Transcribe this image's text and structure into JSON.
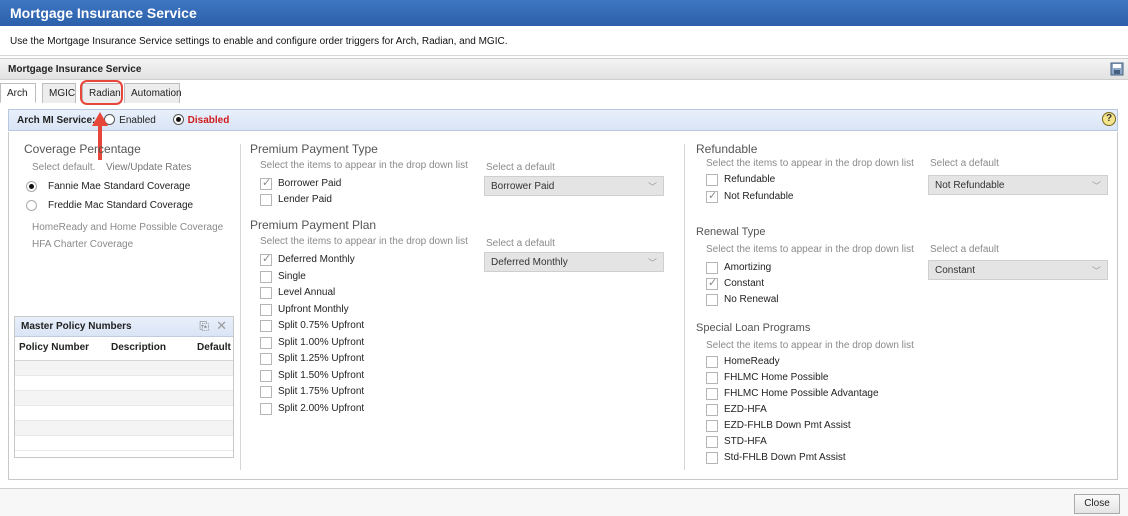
{
  "window": {
    "title": "Mortgage Insurance Service"
  },
  "description": "Use the Mortgage Insurance Service settings to enable and configure order triggers for Arch, Radian, and MGIC.",
  "section_header": "Mortgage Insurance Service",
  "tabs": [
    {
      "label": "Arch",
      "active": true
    },
    {
      "label": "MGIC",
      "active": false
    },
    {
      "label": "Radian",
      "active": false,
      "highlighted": true
    },
    {
      "label": "Automation",
      "active": false
    }
  ],
  "service": {
    "label": "Arch MI Service:",
    "enabled_label": "Enabled",
    "disabled_label": "Disabled",
    "selected": "Disabled"
  },
  "coverage": {
    "title": "Coverage Percentage",
    "select_default": "Select default.",
    "view_rates": "View/Update Rates",
    "options": [
      "Fannie Mae Standard Coverage",
      "Freddie Mac Standard Coverage"
    ],
    "selected": "Fannie Mae Standard Coverage",
    "extra": [
      "HomeReady and Home Possible Coverage",
      "HFA Charter Coverage"
    ]
  },
  "master_policy": {
    "title": "Master Policy Numbers",
    "columns": [
      "Policy Number",
      "Description",
      "Default"
    ]
  },
  "premium_payment_type": {
    "title": "Premium Payment Type",
    "hint": "Select the items to appear in the drop down list",
    "default_label": "Select a default",
    "items": [
      {
        "label": "Borrower Paid",
        "checked": true
      },
      {
        "label": "Lender Paid",
        "checked": false
      }
    ],
    "default_value": "Borrower Paid"
  },
  "premium_payment_plan": {
    "title": "Premium Payment Plan",
    "hint": "Select the items to appear in the drop down list",
    "default_label": "Select a default",
    "items": [
      {
        "label": "Deferred Monthly",
        "checked": true
      },
      {
        "label": "Single",
        "checked": false
      },
      {
        "label": "Level Annual",
        "checked": false
      },
      {
        "label": "Upfront Monthly",
        "checked": false
      },
      {
        "label": "Split 0.75% Upfront",
        "checked": false
      },
      {
        "label": "Split 1.00% Upfront",
        "checked": false
      },
      {
        "label": "Split 1.25% Upfront",
        "checked": false
      },
      {
        "label": "Split 1.50% Upfront",
        "checked": false
      },
      {
        "label": "Split 1.75% Upfront",
        "checked": false
      },
      {
        "label": "Split 2.00% Upfront",
        "checked": false
      }
    ],
    "default_value": "Deferred Monthly"
  },
  "refundable": {
    "title": "Refundable",
    "hint": "Select the items to appear in the drop down list",
    "default_label": "Select a default",
    "items": [
      {
        "label": "Refundable",
        "checked": false
      },
      {
        "label": "Not Refundable",
        "checked": true
      }
    ],
    "default_value": "Not Refundable"
  },
  "renewal_type": {
    "title": "Renewal Type",
    "hint": "Select the items to appear in the drop down list",
    "default_label": "Select a default",
    "items": [
      {
        "label": "Amortizing",
        "checked": false
      },
      {
        "label": "Constant",
        "checked": true
      },
      {
        "label": "No Renewal",
        "checked": false
      }
    ],
    "default_value": "Constant"
  },
  "special_loan": {
    "title": "Special Loan Programs",
    "hint": "Select the items to appear in the drop down list",
    "items": [
      {
        "label": "HomeReady",
        "checked": false
      },
      {
        "label": "FHLMC Home Possible",
        "checked": false
      },
      {
        "label": "FHLMC Home Possible Advantage",
        "checked": false
      },
      {
        "label": "EZD-HFA",
        "checked": false
      },
      {
        "label": "EZD-FHLB Down Pmt Assist",
        "checked": false
      },
      {
        "label": "STD-HFA",
        "checked": false
      },
      {
        "label": "Std-FHLB Down Pmt Assist",
        "checked": false
      }
    ]
  },
  "buttons": {
    "close": "Close"
  },
  "colors": {
    "title_bar": "#2b5fa8",
    "disabled": "#d01c1c",
    "annotation": "#e7463b"
  }
}
